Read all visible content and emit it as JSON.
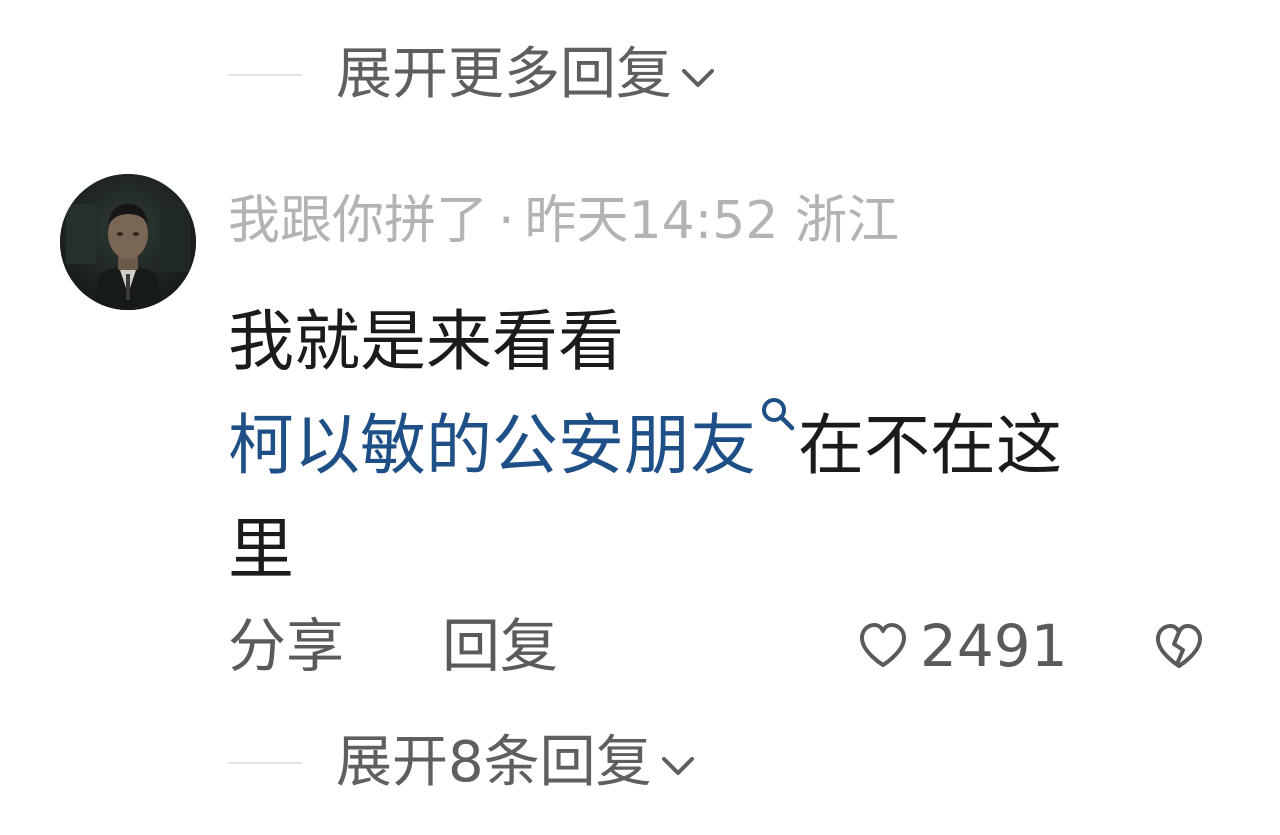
{
  "top_expand": {
    "label": "展开更多回复"
  },
  "comment": {
    "username": "我跟你拼了",
    "separator": "·",
    "time": "昨天14:52",
    "location": "浙江",
    "text_line1": "我就是来看看",
    "link_text": "柯以敏的公安朋友",
    "text_after_link": "在不在这",
    "text_line3": "里",
    "share_label": "分享",
    "reply_label": "回复",
    "like_count": "2491"
  },
  "bottom_expand": {
    "label": "展开8条回复"
  },
  "colors": {
    "link": "#1e4f86",
    "meta": "#b3b3b3",
    "body": "#1b1b1b",
    "action": "#5a5a5a"
  },
  "icons": [
    "chevron-down-icon",
    "search-icon",
    "heart-icon",
    "broken-heart-icon",
    "avatar"
  ]
}
